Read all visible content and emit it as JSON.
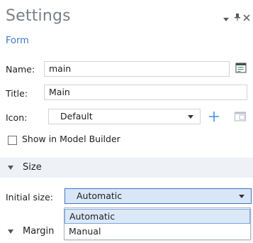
{
  "header": {
    "title": "Settings",
    "subtitle": "Form",
    "controls": {
      "menu_icon": "chevron-down-icon",
      "pin_icon": "pin-icon",
      "close_icon": "close-icon"
    }
  },
  "form": {
    "name_label": "Name:",
    "name_value": "main",
    "title_label": "Title:",
    "title_value": "Main",
    "icon_label": "Icon:",
    "icon_value": "Default",
    "show_in_model_builder_label": "Show in Model Builder",
    "show_in_model_builder_checked": false
  },
  "size_section": {
    "header": "Size",
    "initial_size_label": "Initial size:",
    "initial_size_value": "Automatic",
    "options": [
      "Automatic",
      "Manual"
    ]
  },
  "margins_section": {
    "header": "Margin"
  },
  "colors": {
    "accent": "#3c78c6",
    "section_bg": "#eef2f7",
    "selected_option_bg": "#dbe8f8"
  }
}
